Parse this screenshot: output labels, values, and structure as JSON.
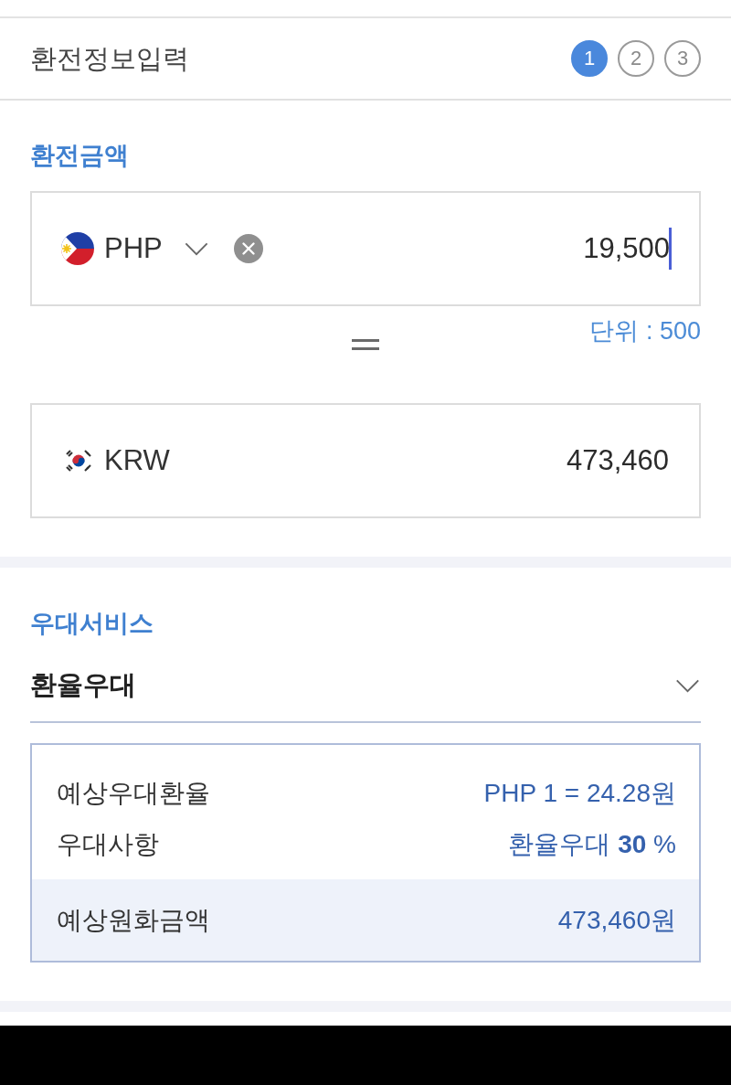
{
  "header": {
    "title": "환전정보입력",
    "steps": [
      {
        "label": "1",
        "selected": true
      },
      {
        "label": "2",
        "selected": false
      },
      {
        "label": "3",
        "selected": false
      }
    ]
  },
  "exchange_amount": {
    "heading": "환전금액",
    "from": {
      "currency": "PHP",
      "value": "19,500",
      "focused": true
    },
    "unit_note": "단위 : 500",
    "to": {
      "currency": "KRW",
      "value": "473,460"
    }
  },
  "preferential_service": {
    "heading": "우대서비스",
    "dropdown": {
      "value": "환율우대"
    },
    "details": {
      "rows": [
        {
          "label": "예상우대환율",
          "value": "PHP 1 = 24.28원"
        },
        {
          "label": "우대사항",
          "value": "환율우대 **30** %"
        }
      ],
      "total": {
        "label": "예상원화금액",
        "value": "473,460원"
      }
    }
  }
}
